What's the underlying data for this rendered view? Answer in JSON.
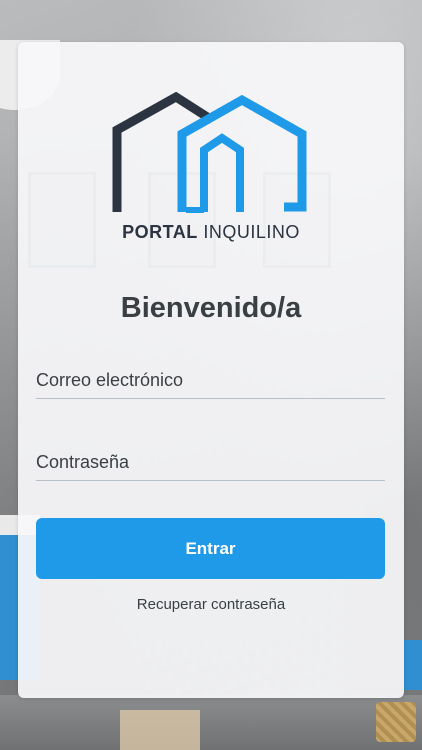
{
  "colors": {
    "accent": "#1f9ae8",
    "logo_dark": "#2b3440",
    "logo_blue": "#1f9ae8",
    "text": "#3a3f44"
  },
  "brand": {
    "logo_icon": "house-outline-logo",
    "name_bold": "PORTAL",
    "name_light": "INQUILINO"
  },
  "login": {
    "title": "Bienvenido/a",
    "email_placeholder": "Correo electrónico",
    "password_placeholder": "Contraseña",
    "submit_label": "Entrar",
    "recover_label": "Recuperar contraseña"
  }
}
